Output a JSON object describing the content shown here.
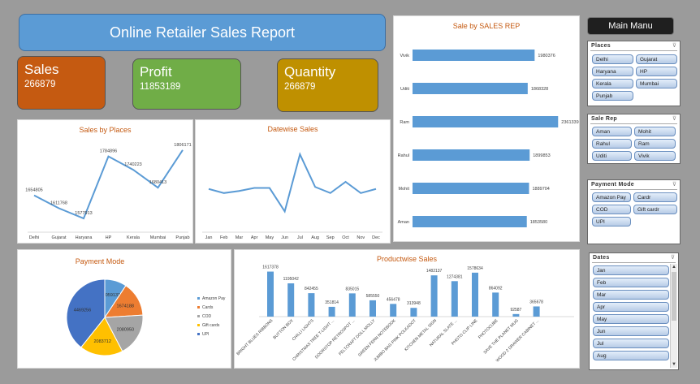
{
  "header": {
    "title": "Online Retailer Sales Report"
  },
  "kpis": {
    "sales": {
      "label": "Sales",
      "value": "266879"
    },
    "profit": {
      "label": "Profit",
      "value": "11853189"
    },
    "quantity": {
      "label": "Quantity",
      "value": "266879"
    }
  },
  "menu": {
    "label": "Main Manu"
  },
  "colors": {
    "sales_card": "#c55a11",
    "profit_card": "#70ad47",
    "quantity_card": "#bf9000",
    "accent": "#5b9bd5",
    "title_text": "#c55a11"
  },
  "slicers": {
    "places": {
      "title": "Places",
      "items": [
        "Delhi",
        "Gujarat",
        "Haryana",
        "HP",
        "Kerala",
        "Mumbai",
        "Punjab"
      ]
    },
    "sale_rep": {
      "title": "Sale Rep",
      "items": [
        "Aman",
        "Mohit",
        "Rahul",
        "Ram",
        "Uditi",
        "Vivik"
      ]
    },
    "payment_mode": {
      "title": "Payment Mode",
      "items": [
        "Amazon Pay",
        "Cardr",
        "COD",
        "Gift cardr",
        "UPI"
      ]
    },
    "dates": {
      "title": "Dates",
      "items": [
        "Jan",
        "Feb",
        "Mar",
        "Apr",
        "May",
        "Jun",
        "Jul",
        "Aug"
      ]
    }
  },
  "chart_data": [
    {
      "id": "sales_by_places",
      "type": "line",
      "title": "Sales by Places",
      "categories": [
        "Delhi",
        "Gujarat",
        "Haryana",
        "HP",
        "Kerala",
        "Mumbai",
        "Punjab"
      ],
      "values": [
        1654805,
        1611768,
        1577913,
        1784896,
        1740223,
        1680413,
        1806171
      ],
      "data_labels": [
        "1654805",
        "1611768",
        "1577913",
        "1784896",
        "1740223",
        "1680413",
        "1806171"
      ],
      "ylim": [
        1540000,
        1830000
      ]
    },
    {
      "id": "datewise_sales",
      "type": "line",
      "title": "Datewise Sales",
      "categories": [
        "Jan",
        "Feb",
        "Mar",
        "Apr",
        "May",
        "Jun",
        "Jul",
        "Aug",
        "Sep",
        "Oct",
        "Nov",
        "Dec"
      ],
      "values": [
        1000000,
        960000,
        980000,
        1010000,
        1010000,
        780000,
        1340000,
        1020000,
        960000,
        1070000,
        960000,
        1000000
      ],
      "ylim": [
        600000,
        1500000
      ]
    },
    {
      "id": "sale_by_sales_rep",
      "type": "bar",
      "orientation": "horizontal",
      "title": "Sale by SALES REP",
      "categories": [
        "Vivik",
        "Uditi",
        "Ram",
        "Rahul",
        "Mohit",
        "Aman"
      ],
      "values": [
        1980376,
        1868328,
        2361339,
        1899853,
        1889704,
        1853580
      ],
      "data_labels": [
        "1980376",
        "1868328",
        "2361339",
        "1899853",
        "1889704",
        "1853580"
      ],
      "xlim": [
        0,
        2450000
      ]
    },
    {
      "id": "payment_mode",
      "type": "pie",
      "title": "Payment Mode",
      "categories": [
        "Amazon Pay",
        "Cards",
        "COD",
        "Gift cards",
        "UPI"
      ],
      "values": [
        1059133,
        1674188,
        2080950,
        2083712,
        4469256
      ],
      "data_labels": [
        "1059133",
        "1674188",
        "2080950",
        "2083712",
        "4469256"
      ],
      "colors": [
        "#5b9bd5",
        "#ed7d31",
        "#a5a5a5",
        "#ffc000",
        "#4472c4"
      ],
      "legend_position": "right"
    },
    {
      "id": "productwise_sales",
      "type": "bar",
      "title": "Productwise Sales",
      "categories": [
        "BRIGHT BLUES RIBBONS",
        "BUTTON BOX",
        "CHILLI LIGHTS",
        "CHRISTMAS TREE T-LIGHT ...",
        "DOORSTOP RETROSPOT ...",
        "FELTCRAFT DOLL MOLLY",
        "GREEN FERN NOTEBOOK",
        "JUMBO BAG PINK POLKADOT",
        "KITCHEN METAL SIGN",
        "NATURAL SLATE ...",
        "PHOTO CLIP LINE",
        "PHOTOCUBE",
        "SAVE THE PLANET MUG",
        "WOOD 2 DRAWER CABINET ..."
      ],
      "values": [
        1617378,
        1195042,
        842455,
        351814,
        835015,
        585550,
        456478,
        313948,
        1482137,
        1274381,
        1578634,
        864092,
        92587,
        365678
      ],
      "data_labels": [
        "1617378",
        "1195042",
        "842455",
        "351814",
        "835015",
        "585550",
        "456478",
        "313948",
        "1482137",
        "1274381",
        "1578634",
        "864092",
        "92587",
        "365678"
      ],
      "ylim": [
        0,
        1750000
      ]
    }
  ]
}
